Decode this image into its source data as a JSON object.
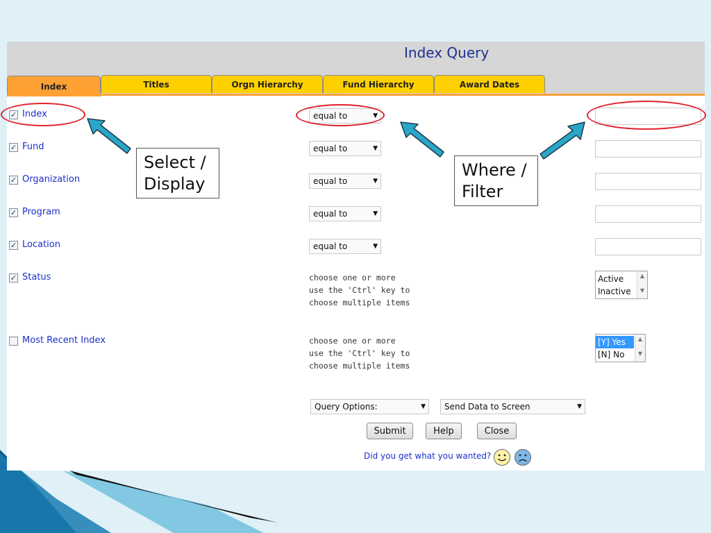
{
  "app": {
    "title": "Index Query",
    "tabs": [
      {
        "label": "Index",
        "active": true
      },
      {
        "label": "Titles",
        "active": false
      },
      {
        "label": "Orgn Hierarchy",
        "active": false
      },
      {
        "label": "Fund Hierarchy",
        "active": false
      },
      {
        "label": "Award Dates",
        "active": false
      }
    ]
  },
  "fields": [
    {
      "label": "Index",
      "checked": true,
      "operator": "equal to",
      "value": ""
    },
    {
      "label": "Fund",
      "checked": true,
      "operator": "equal to",
      "value": ""
    },
    {
      "label": "Organization",
      "checked": true,
      "operator": "equal to",
      "value": ""
    },
    {
      "label": "Program",
      "checked": true,
      "operator": "equal to",
      "value": ""
    },
    {
      "label": "Location",
      "checked": true,
      "operator": "equal to",
      "value": ""
    }
  ],
  "status": {
    "label": "Status",
    "checked": true,
    "hint": [
      "choose one or more",
      "use the 'Ctrl' key to",
      "choose multiple items"
    ],
    "options": [
      {
        "label": "Active",
        "selected": false
      },
      {
        "label": "Inactive",
        "selected": false
      }
    ]
  },
  "most_recent": {
    "label": "Most Recent Index",
    "checked": false,
    "hint": [
      "choose one or more",
      "use the 'Ctrl' key to",
      "choose multiple items"
    ],
    "options": [
      {
        "label": "[Y] Yes",
        "selected": true
      },
      {
        "label": "[N] No",
        "selected": false
      }
    ]
  },
  "footer": {
    "query_options": "Query Options:",
    "output": "Send Data to Screen",
    "submit_label": "Submit",
    "help_label": "Help",
    "close_label": "Close",
    "feedback_text": "Did you get what you wanted?",
    "happy_icon": "smiley-happy-icon",
    "sad_icon": "smiley-sad-icon"
  },
  "annotations": {
    "select_display_line1": "Select /",
    "select_display_line2": "Display",
    "where_filter_line1": "Where /",
    "where_filter_line2": "Filter",
    "arrow_color": "#2aa6c8",
    "ring_color": "#e0202a"
  },
  "colors": {
    "tab_active": "#ffa033",
    "tab_inactive": "#ffd000",
    "label_blue": "#1b2fc9",
    "title_blue": "#1e2f8f",
    "slide_background": "#dff0f7"
  }
}
